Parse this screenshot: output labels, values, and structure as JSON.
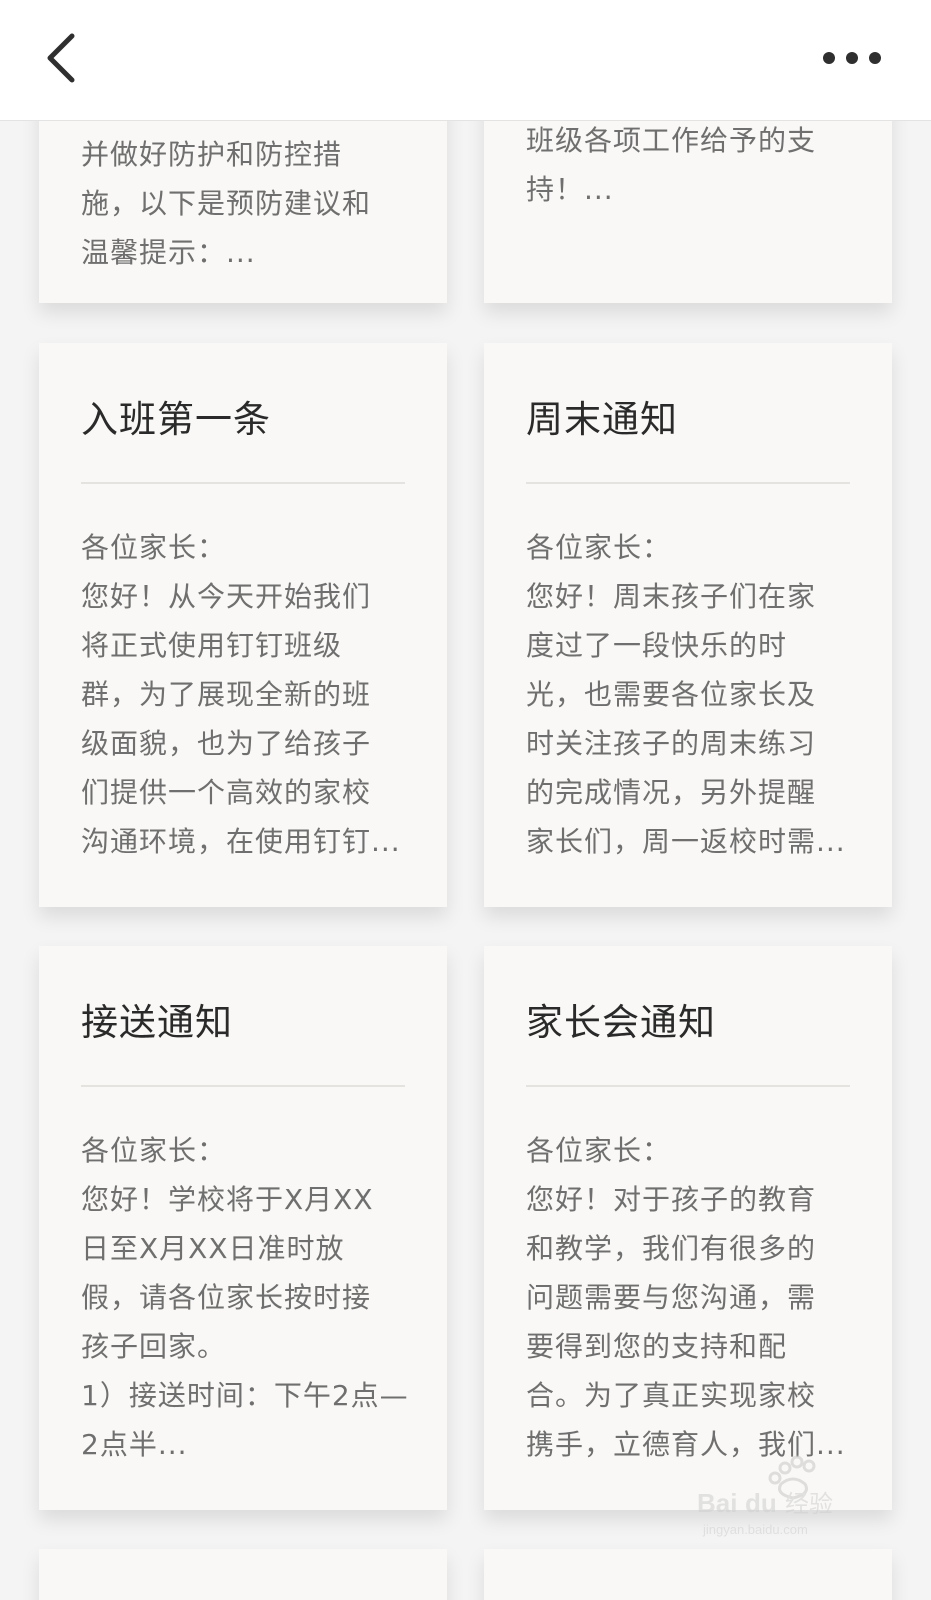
{
  "header": {
    "back_icon": "chevron-left-icon",
    "more_icon": "more-horizontal-icon"
  },
  "partial_cards": [
    {
      "text": "病毒感染的肺炎的知识\n并做好防护和防控措\n施，以下是预防建议和\n温馨提示：..."
    },
    {
      "text": "此感谢各位家长对我们\n班级各项工作给予的支\n持！..."
    }
  ],
  "cards": [
    {
      "title": "入班第一条",
      "body": "各位家长：\n您好！从今天开始我们\n将正式使用钉钉班级\n群，为了展现全新的班\n级面貌，也为了给孩子\n们提供一个高效的家校\n沟通环境，在使用钉钉..."
    },
    {
      "title": "周末通知",
      "body": "各位家长：\n您好！周末孩子们在家\n度过了一段快乐的时\n光，也需要各位家长及\n时关注孩子的周末练习\n的完成情况，另外提醒\n家长们，周一返校时需..."
    },
    {
      "title": "接送通知",
      "body": "各位家长：\n您好！学校将于X月XX\n日至X月XX日准时放\n假，请各位家长按时接\n孩子回家。\n1）接送时间：下午2点—\n2点半..."
    },
    {
      "title": "家长会通知",
      "body": "各位家长：\n您好！对于孩子的教育\n和教学，我们有很多的\n问题需要与您沟通，需\n要得到您的支持和配\n合。为了真正实现家校\n携手，立德育人，我们..."
    }
  ],
  "colors": {
    "background": "#f4f4f4",
    "card": "#f9f8f6",
    "title": "#2a2a2a",
    "body": "#6f6f6f"
  }
}
